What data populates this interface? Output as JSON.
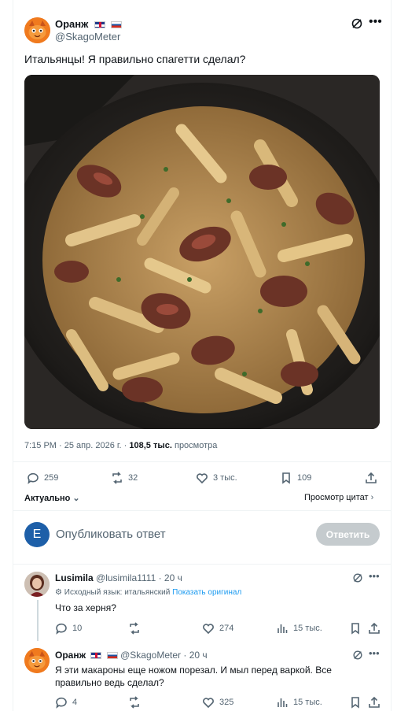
{
  "main_post": {
    "author_name": "Оранж",
    "author_handle": "@SkagoMeter",
    "text": "Итальянцы! Я правильно спагетти сделал?",
    "time": "7:15 PM · 25 апр. 2026 г. ·",
    "views_count": "108,5 тыс.",
    "views_label": "просмотра",
    "stats": {
      "replies": "259",
      "reposts": "32",
      "likes": "3 тыс.",
      "bookmarks": "109"
    },
    "sort_label": "Актуально",
    "quotes_link": "Просмотр цитат"
  },
  "reply_box": {
    "avatar_letter": "E",
    "placeholder": "Опубликовать ответ",
    "button_label": "Ответить"
  },
  "replies": [
    {
      "author_name": "Lusimila",
      "author_handle": "@lusimila1111",
      "time": "· 20 ч",
      "translation_note": "Исходный язык: итальянский",
      "translation_link": "Показать оригинал",
      "text": "Что за херня?",
      "stats": {
        "replies": "10",
        "reposts": "",
        "likes": "274",
        "views": "15 тыс."
      }
    },
    {
      "author_name": "Оранж",
      "author_handle": "@SkagoMeter",
      "time": "· 20 ч",
      "text": "Я эти макароны еще ножом порезал. И мыл перед варкой. Все правильно ведь сделал?",
      "stats": {
        "replies": "4",
        "reposts": "",
        "likes": "325",
        "views": "15 тыс."
      }
    }
  ],
  "colors": {
    "accent": "#1d9bf0",
    "muted": "#536471",
    "reply_button_bg": "#c5cbce",
    "avatar_orange": "#f07a1e",
    "reply_avatar_bg": "#1d5fa8"
  }
}
